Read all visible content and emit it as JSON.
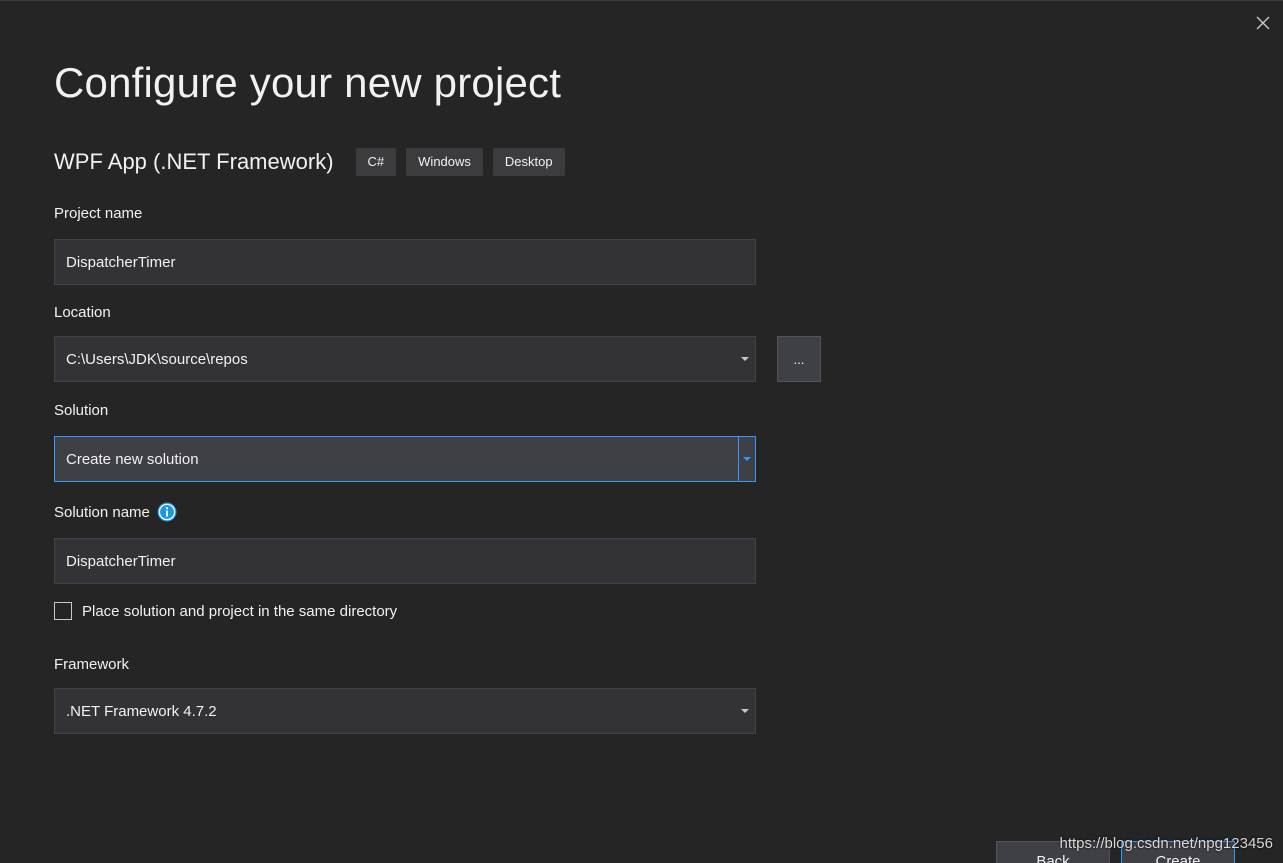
{
  "dialog": {
    "title": "Configure your new project",
    "close_icon": "close-icon"
  },
  "template": {
    "name": "WPF App (.NET Framework)",
    "tags": [
      "C#",
      "Windows",
      "Desktop"
    ]
  },
  "project_name": {
    "label": "Project name",
    "value": "DispatcherTimer"
  },
  "location": {
    "label": "Location",
    "value": "C:\\Users\\JDK\\source\\repos",
    "browse_label": "..."
  },
  "solution": {
    "label": "Solution",
    "value": "Create new solution"
  },
  "solution_name": {
    "label": "Solution name",
    "value": "DispatcherTimer",
    "info_icon": "info-icon"
  },
  "same_directory": {
    "label": "Place solution and project in the same directory",
    "checked": false
  },
  "framework": {
    "label": "Framework",
    "value": ".NET Framework 4.7.2"
  },
  "footer": {
    "back_label": "Back",
    "create_label": "Create"
  },
  "watermark": "https://blog.csdn.net/npg123456",
  "colors": {
    "background": "#252526",
    "input_background": "#333337",
    "accent": "#3399ff",
    "info_icon": "#1c97ea"
  }
}
